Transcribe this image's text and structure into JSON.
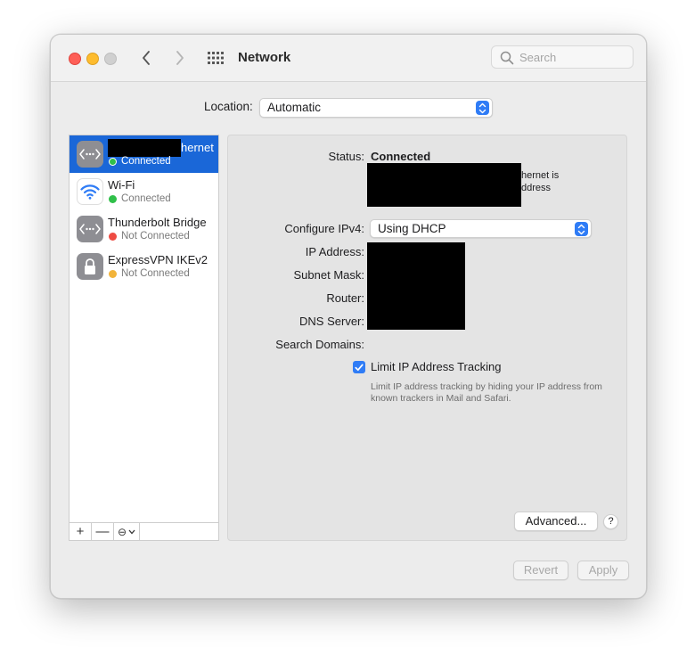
{
  "window": {
    "title": "Network",
    "search_placeholder": "Search"
  },
  "location": {
    "label": "Location:",
    "value": "Automatic"
  },
  "services": [
    {
      "name_visible": "hernet",
      "status": "Connected",
      "status_color": "#30c04a",
      "icon": "ethernet-icon",
      "selected": true
    },
    {
      "name": "Wi-Fi",
      "status": "Connected",
      "status_color": "#30c04a",
      "icon": "wifi-icon"
    },
    {
      "name": "Thunderbolt Bridge",
      "status": "Not Connected",
      "status_color": "#ee4b43",
      "icon": "ethernet-icon"
    },
    {
      "name": "ExpressVPN IKEv2",
      "status": "Not Connected",
      "status_color": "#f2b43a",
      "icon": "lock-icon"
    }
  ],
  "sidebar_toolbar": {
    "add": "+",
    "remove": "—",
    "action": "⊖"
  },
  "detail": {
    "status_label": "Status:",
    "status_value": "Connected",
    "status_desc_line1": "hernet is",
    "status_desc_line2": "ddress",
    "configure_label": "Configure IPv4:",
    "configure_value": "Using DHCP",
    "ip_label": "IP Address:",
    "subnet_label": "Subnet Mask:",
    "router_label": "Router:",
    "dns_label": "DNS Server:",
    "search_domains_label": "Search Domains:",
    "limit_tracking_label": "Limit IP Address Tracking",
    "limit_tracking_checked": true,
    "limit_tracking_note": "Limit IP address tracking by hiding your IP address from known trackers in Mail and Safari.",
    "advanced_button": "Advanced...",
    "help_button": "?"
  },
  "footer": {
    "revert_button": "Revert",
    "apply_button": "Apply"
  },
  "colors": {
    "accent": "#1a67d8",
    "popup_accent": "#2f7cf6"
  }
}
